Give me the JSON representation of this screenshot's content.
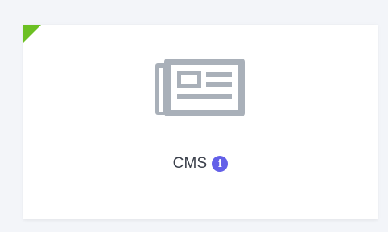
{
  "card": {
    "label": "CMS",
    "icon": "newspaper-icon",
    "info_icon": "info-icon",
    "info_glyph": "i",
    "corner_color": "#6cc023",
    "icon_color": "#a9b0b9",
    "info_color": "#6360e8"
  }
}
